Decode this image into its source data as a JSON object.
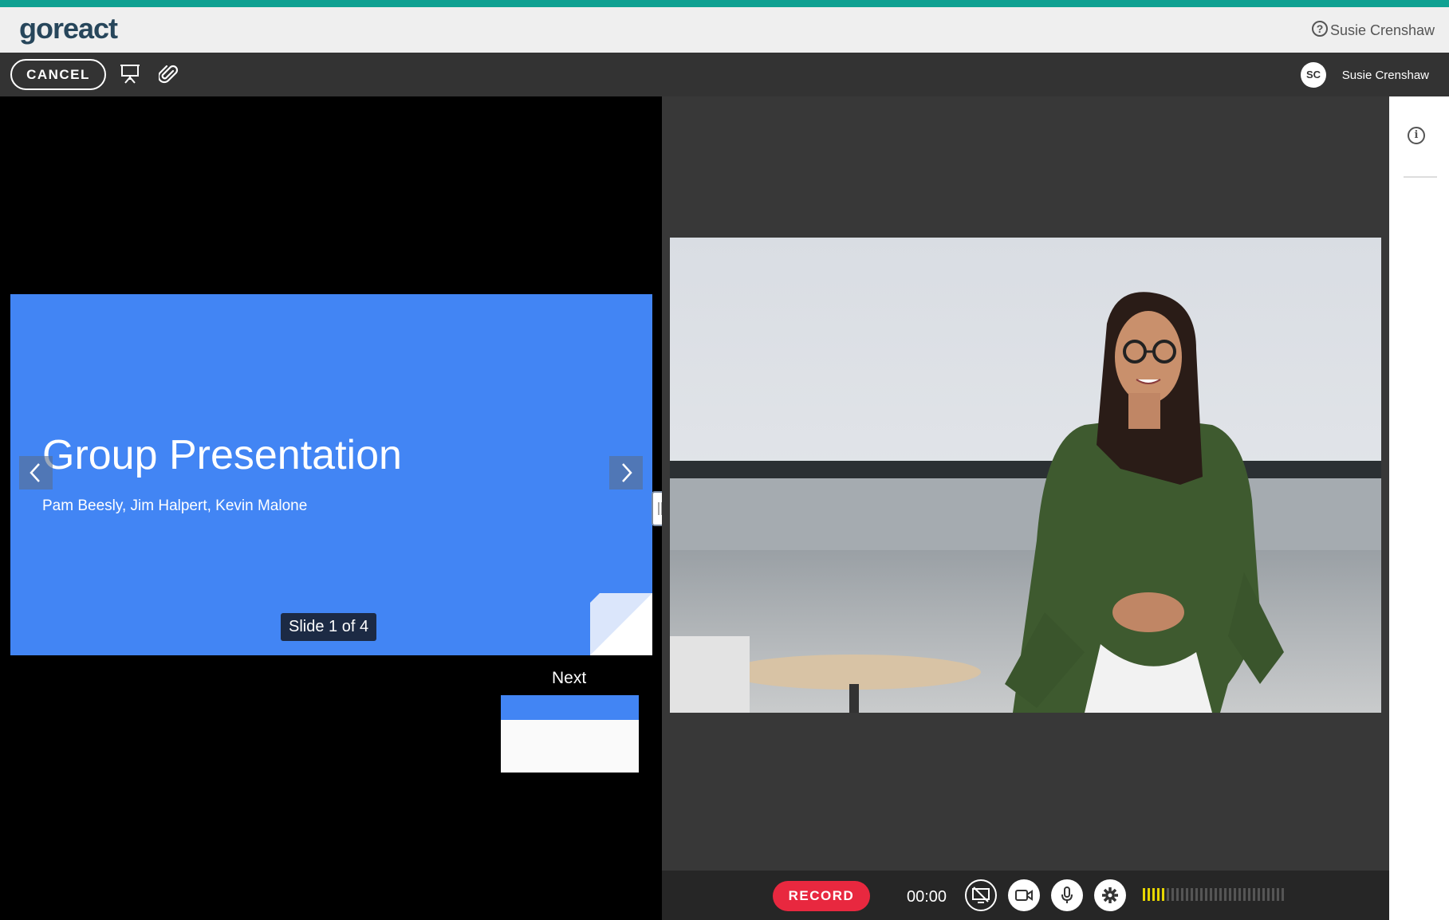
{
  "header": {
    "logo_text": "goreact",
    "user_name": "Susie Crenshaw",
    "help_icon": "help-circle-icon"
  },
  "toolbar": {
    "cancel_label": "CANCEL",
    "presentation_icon": "presentation-icon",
    "attachment_icon": "paperclip-icon",
    "avatar_initials": "SC",
    "user_name": "Susie Crenshaw"
  },
  "slide": {
    "title": "Group Presentation",
    "subtitle": "Pam Beesly, Jim Halpert, Kevin Malone",
    "counter": "Slide 1 of 4",
    "current": 1,
    "total": 4,
    "bg_color": "#4285f4"
  },
  "next_preview": {
    "label": "Next"
  },
  "controls": {
    "record_label": "RECORD",
    "timer": "00:00",
    "buttons": [
      "screen-share-off-icon",
      "camera-icon",
      "microphone-icon",
      "settings-icon"
    ],
    "audio_level": 0.17,
    "record_color": "#e8283f",
    "meter_color": "#e6d600"
  },
  "sidebar": {
    "info_icon": "info-icon"
  },
  "colors": {
    "accent": "#0fa192",
    "toolbar_bg": "#333333"
  }
}
